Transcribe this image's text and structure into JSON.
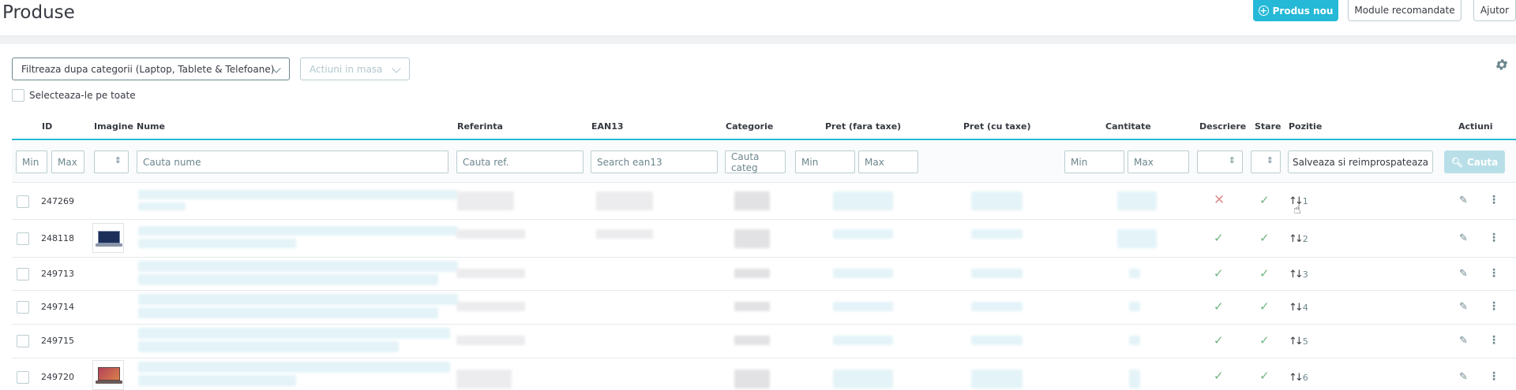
{
  "header": {
    "title": "Produse",
    "new_product": "Produs nou",
    "modules": "Module recomandate",
    "help": "Ajutor"
  },
  "toolbar": {
    "category_filter": "Filtreaza dupa categorii (Laptop, Tablete & Telefoane)",
    "mass_actions": "Actiuni in masa",
    "select_all": "Selecteaza-le pe toate"
  },
  "columns": {
    "id": "ID",
    "image": "Imagine",
    "name": "Nume",
    "reference": "Referinta",
    "ean13": "EAN13",
    "category": "Categorie",
    "price_excl": "Pret (fara taxe)",
    "price_incl": "Pret (cu taxe)",
    "quantity": "Cantitate",
    "description": "Descriere",
    "status": "Stare",
    "position": "Pozitie",
    "actions": "Actiuni"
  },
  "filters": {
    "id_min": "Min",
    "id_max": "Max",
    "name": "Cauta nume",
    "reference": "Cauta ref.",
    "ean13": "Search ean13",
    "category": "Cauta categ",
    "price_min": "Min",
    "price_max": "Max",
    "qty_min": "Min",
    "qty_max": "Max",
    "save_refresh": "Salveaza si reimprospateaza",
    "search": "Cauta"
  },
  "rows": [
    {
      "id": "247269",
      "description": "no",
      "status": "yes",
      "position": "1",
      "has_image": false
    },
    {
      "id": "248118",
      "description": "yes",
      "status": "yes",
      "position": "2",
      "has_image": true
    },
    {
      "id": "249713",
      "description": "yes",
      "status": "yes",
      "position": "3",
      "has_image": false
    },
    {
      "id": "249714",
      "description": "yes",
      "status": "yes",
      "position": "4",
      "has_image": false
    },
    {
      "id": "249715",
      "description": "yes",
      "status": "yes",
      "position": "5",
      "has_image": false
    },
    {
      "id": "249720",
      "description": "yes",
      "status": "yes",
      "position": "6",
      "has_image": true
    }
  ],
  "colors": {
    "primary": "#25b9d7",
    "success": "#70b580",
    "danger": "#e08f8f",
    "text": "#363a41"
  },
  "icons": [
    "plus-circle-icon",
    "chevron-down-icon",
    "gear-icon",
    "search-icon",
    "check-icon",
    "close-icon",
    "sort-icon",
    "pencil-icon",
    "more-vertical-icon"
  ]
}
